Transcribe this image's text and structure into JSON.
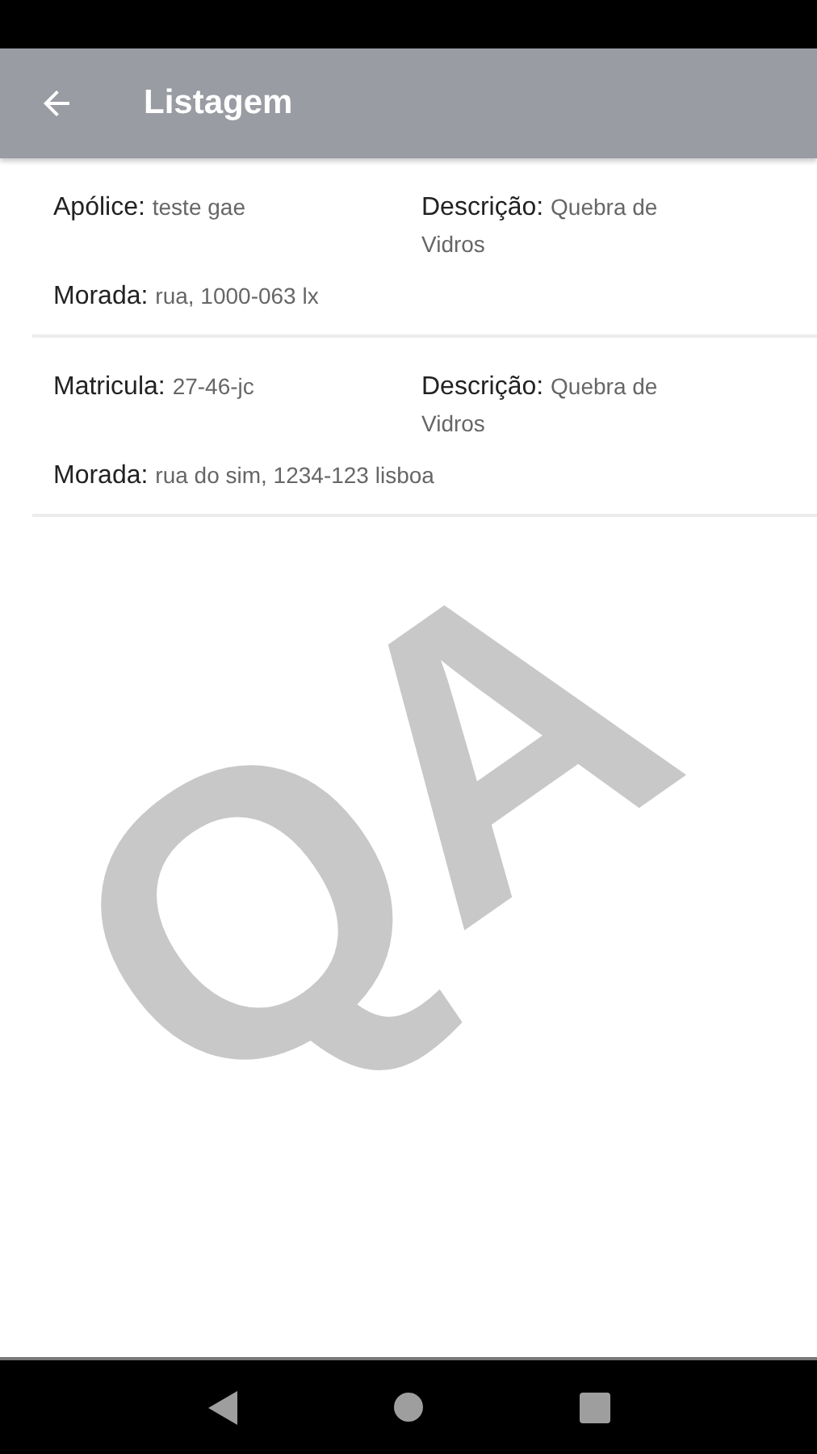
{
  "app_bar": {
    "title": "Listagem"
  },
  "items": [
    {
      "primary": {
        "label": "Apólice:",
        "value": "teste gae"
      },
      "description": {
        "label": "Descrição:",
        "value": "Quebra de Vidros"
      },
      "address": {
        "label": "Morada:",
        "value": "rua, 1000-063 lx"
      }
    },
    {
      "primary": {
        "label": "Matricula:",
        "value": "27-46-jc"
      },
      "description": {
        "label": "Descrição:",
        "value": "Quebra de Vidros"
      },
      "address": {
        "label": "Morada:",
        "value": "rua do sim, 1234-123 lisboa"
      }
    }
  ],
  "environment_mark": "QA"
}
